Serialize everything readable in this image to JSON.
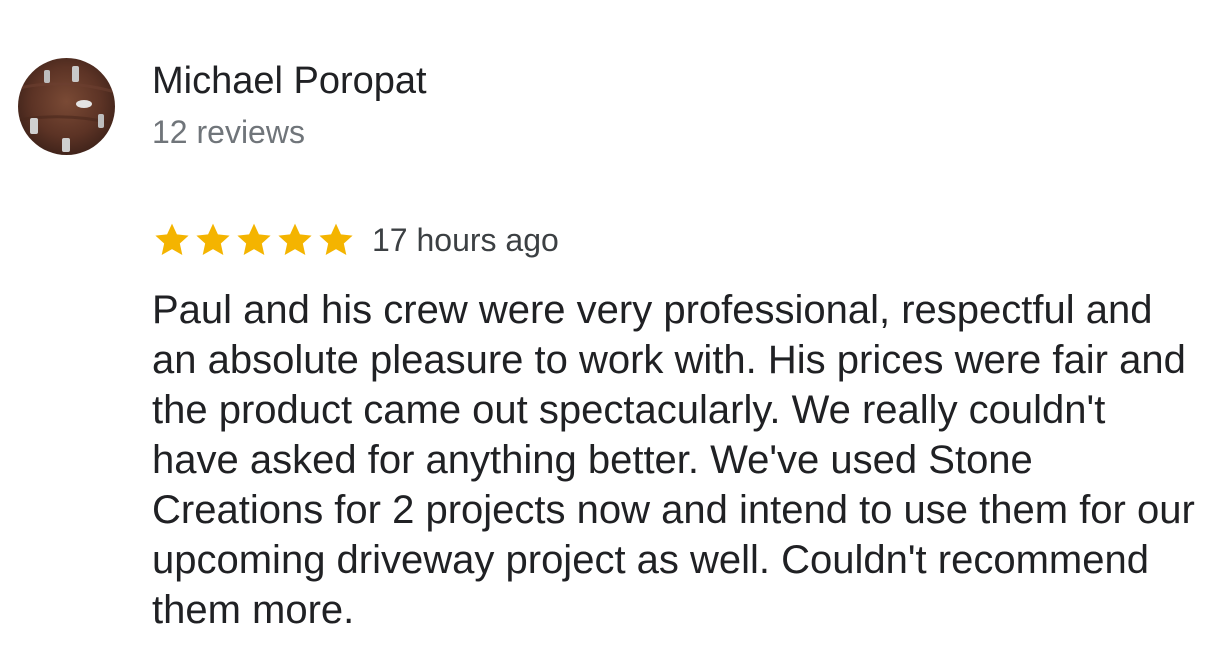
{
  "review": {
    "author_name": "Michael Poropat",
    "author_reviews": "12 reviews",
    "rating": 5,
    "rating_max": 5,
    "time": "17 hours ago",
    "text": "Paul and his crew were very professional, respectful and an absolute pleasure to work with. His prices were fair and the product came out spectacularly. We really couldn't have asked for anything better. We've used Stone Creations for 2 projects now and intend to use them for our upcoming driveway project as well. Couldn't recommend them more."
  },
  "colors": {
    "star": "#f4b400",
    "name": "#202124",
    "secondary": "#70757a",
    "text": "#202124"
  },
  "icons": {
    "avatar": "avatar-photo",
    "star": "star-icon"
  }
}
